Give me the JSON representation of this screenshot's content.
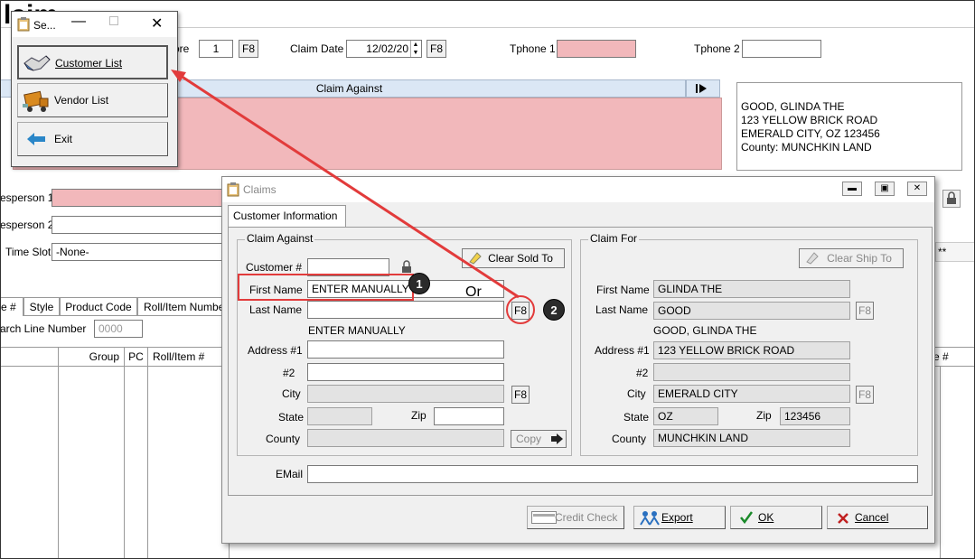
{
  "background": {
    "title_fragment": "laim",
    "store_label": "ore",
    "store_value": "1",
    "f8": "F8",
    "claim_date_label": "Claim Date",
    "claim_date_value": "12/02/20",
    "tphone1_label": "Tphone 1",
    "tphone2_label": "Tphone 2",
    "claim_against_header": "Claim Against",
    "address_block": [
      "GOOD, GLINDA THE",
      "123 YELLOW BRICK ROAD",
      "EMERALD CITY, OZ  123456",
      "County: MUNCHKIN LAND"
    ],
    "salesperson1_label": "esperson 1",
    "salesperson2_label": "esperson 2",
    "time_slot_label": "Time Slot",
    "time_slot_value": "-None-",
    "tabs": [
      "e #",
      "Style",
      "Product Code",
      "Roll/Item Numbe"
    ],
    "search_line_label": "arch Line Number",
    "search_line_placeholder": "0000",
    "grid_headers": [
      "Group",
      "PC",
      "Roll/Item #",
      "e #"
    ],
    "right_stars": "**"
  },
  "menu": {
    "title": "Se...",
    "items": [
      "Customer List",
      "Vendor List",
      "Exit"
    ]
  },
  "dialog": {
    "title": "Claims",
    "tab": "Customer Information",
    "claim_against": {
      "legend": "Claim Against",
      "customer_label": "Customer #",
      "first_name_label": "First Name",
      "first_name_value": "ENTER MANUALLY",
      "last_name_label": "Last Name",
      "last_name_value": "",
      "full_name_display": "ENTER MANUALLY",
      "address1_label": "Address #1",
      "address2_label": "#2",
      "city_label": "City",
      "state_label": "State",
      "zip_label": "Zip",
      "county_label": "County",
      "clear_button": "Clear Sold To",
      "copy_button": "Copy",
      "f8": "F8"
    },
    "claim_for": {
      "legend": "Claim For",
      "clear_button": "Clear Ship To",
      "first_name_label": "First Name",
      "first_name_value": "GLINDA THE",
      "last_name_label": "Last Name",
      "last_name_value": "GOOD",
      "full_name_display": "GOOD, GLINDA THE",
      "address1_label": "Address #1",
      "address1_value": "123 YELLOW BRICK ROAD",
      "address2_label": "#2",
      "city_label": "City",
      "city_value": "EMERALD CITY",
      "state_label": "State",
      "state_value": "OZ",
      "zip_label": "Zip",
      "zip_value": "123456",
      "county_label": "County",
      "county_value": "MUNCHKIN LAND",
      "f8": "F8"
    },
    "email_label": "EMail",
    "buttons": {
      "credit_check": "Credit Check",
      "export": "Export",
      "ok": "OK",
      "cancel": "Cancel"
    }
  },
  "annotations": {
    "or_text": "Or",
    "badge1": "1",
    "badge2": "2",
    "highlight_color": "#e23b3b"
  }
}
